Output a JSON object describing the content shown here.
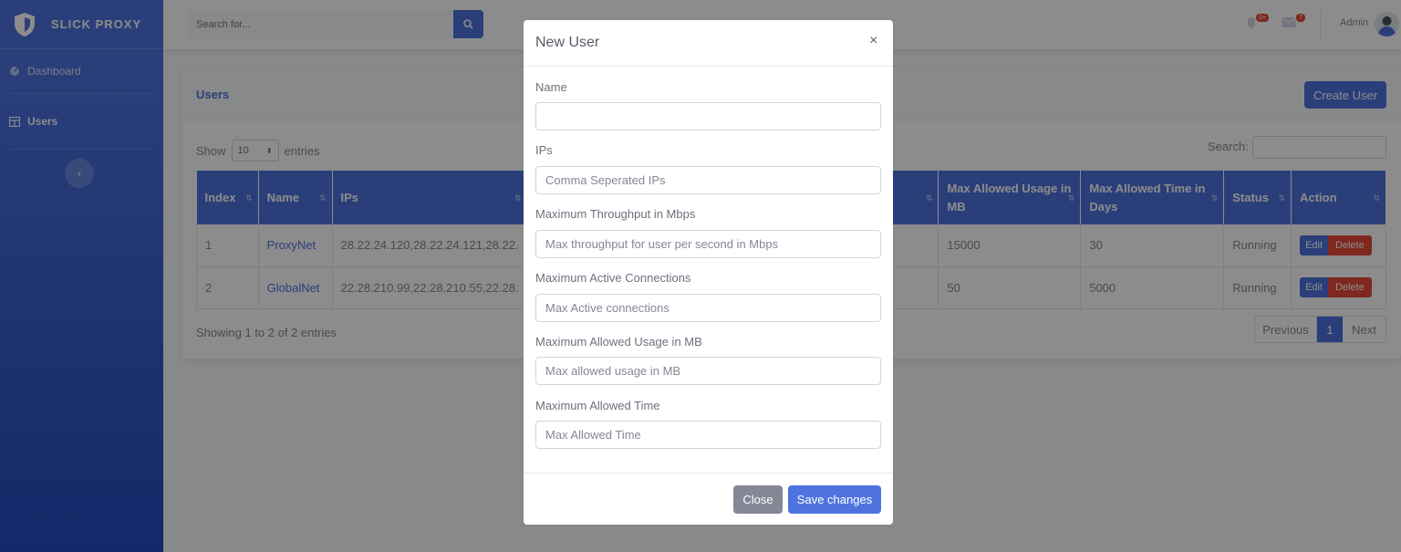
{
  "brand": {
    "name": "SLICK PROXY"
  },
  "sidebar": {
    "items": [
      {
        "label": "Dashboard",
        "icon": "dashboard-icon"
      },
      {
        "label": "Users",
        "icon": "table-icon"
      }
    ],
    "toggle_glyph": "‹"
  },
  "topbar": {
    "search_placeholder": "Search for...",
    "alerts_badge": "3+",
    "messages_badge": "7",
    "user_name": "Admin"
  },
  "card": {
    "title": "Users",
    "create_label": "Create User",
    "show_label": "Show",
    "entries_label": "entries",
    "page_size": "10",
    "search_label": "Search:",
    "columns": [
      "Index",
      "Name",
      "IPs",
      "",
      "Max Allowed Usage in MB",
      "Max Allowed Time in Days",
      "Status",
      "Action"
    ],
    "rows": [
      {
        "index": "1",
        "name": "ProxyNet",
        "ips": "28.22.24.120,28.22.24.121,28.22.",
        "usage": "15000",
        "time": "30",
        "status": "Running"
      },
      {
        "index": "2",
        "name": "GlobalNet",
        "ips": "22.28.210.99,22.28.210.55,22.28.",
        "usage": "50",
        "time": "5000",
        "status": "Running"
      }
    ],
    "edit_label": "Edit",
    "delete_label": "Delete",
    "showing_text": "Showing 1 to 2 of 2 entries",
    "pager": {
      "prev": "Previous",
      "current": "1",
      "next": "Next"
    }
  },
  "modal": {
    "title": "New User",
    "close_glyph": "×",
    "fields": [
      {
        "label": "Name",
        "placeholder": ""
      },
      {
        "label": "IPs",
        "placeholder": "Comma Seperated IPs"
      },
      {
        "label": "Maximum Throughput in Mbps",
        "placeholder": "Max throughput for user per second in Mbps"
      },
      {
        "label": "Maximum Active Connections",
        "placeholder": "Max Active connections"
      },
      {
        "label": "Maximum Allowed Usage in MB",
        "placeholder": "Max allowed usage in MB"
      },
      {
        "label": "Maximum Allowed Time",
        "placeholder": "Max Allowed Time"
      }
    ],
    "close_label": "Close",
    "save_label": "Save changes"
  },
  "colors": {
    "primary": "#4e73df",
    "danger": "#e74a3b",
    "secondary": "#858796"
  }
}
